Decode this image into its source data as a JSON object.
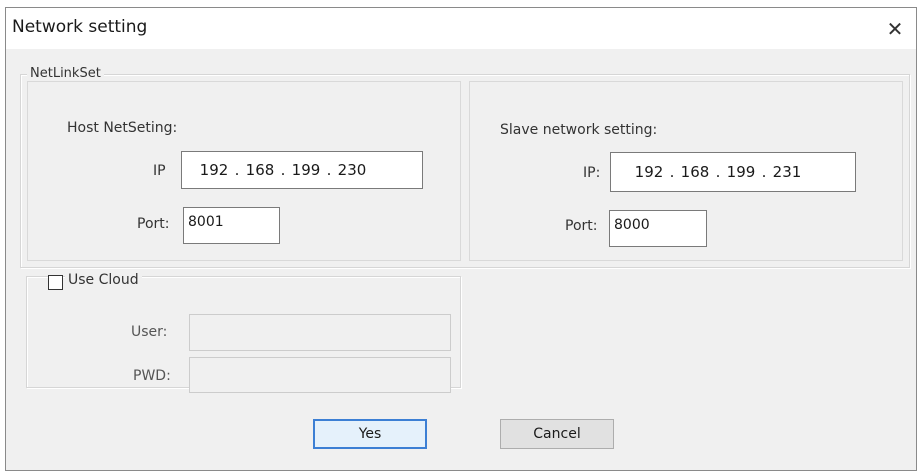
{
  "window": {
    "title": "Network setting",
    "close_glyph": "✕"
  },
  "netlink": {
    "legend": "NetLinkSet",
    "host": {
      "heading": "Host NetSeting:",
      "ip_label": "IP",
      "ip": [
        "192",
        "168",
        "199",
        "230"
      ],
      "port_label": "Port:",
      "port": "8001"
    },
    "slave": {
      "heading": "Slave network setting:",
      "ip_label": "IP:",
      "ip": [
        "192",
        "168",
        "199",
        "231"
      ],
      "port_label": "Port:",
      "port": "8000"
    }
  },
  "cloud": {
    "checkbox_label": "Use Cloud",
    "checked": false,
    "user_label": "User:",
    "user_value": "",
    "pwd_label": "PWD:",
    "pwd_value": ""
  },
  "buttons": {
    "yes": "Yes",
    "cancel": "Cancel"
  },
  "icons": {
    "close": "close-icon"
  },
  "colors": {
    "default_button_border": "#3c7fd4",
    "dialog_bg": "#f0f0f0"
  }
}
